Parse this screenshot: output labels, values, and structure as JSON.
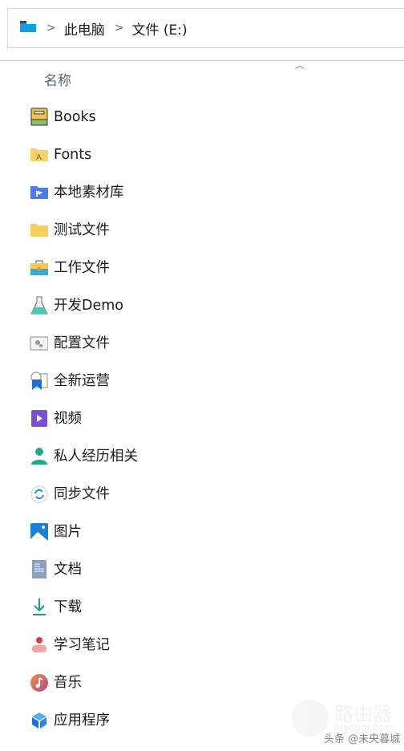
{
  "address_bar": {
    "icon": "folder-icon",
    "crumbs": [
      "此电脑",
      "文件 (E:)"
    ]
  },
  "column_header": {
    "name": "名称",
    "sort": "ascending"
  },
  "items": [
    {
      "label": "Books",
      "icon": "book-icon"
    },
    {
      "label": "Fonts",
      "icon": "fonts-folder-icon"
    },
    {
      "label": "本地素材库",
      "icon": "blue-folder-icon"
    },
    {
      "label": "测试文件",
      "icon": "folder-icon"
    },
    {
      "label": "工作文件",
      "icon": "briefcase-icon"
    },
    {
      "label": "开发Demo",
      "icon": "flask-icon"
    },
    {
      "label": "配置文件",
      "icon": "settings-file-icon"
    },
    {
      "label": "全新运营",
      "icon": "bookmark-doc-icon"
    },
    {
      "label": "视频",
      "icon": "video-icon"
    },
    {
      "label": "私人经历相关",
      "icon": "person-icon"
    },
    {
      "label": "同步文件",
      "icon": "sync-icon"
    },
    {
      "label": "图片",
      "icon": "picture-icon"
    },
    {
      "label": "文档",
      "icon": "document-icon"
    },
    {
      "label": "下载",
      "icon": "download-icon"
    },
    {
      "label": "学习笔记",
      "icon": "notes-icon"
    },
    {
      "label": "音乐",
      "icon": "music-icon"
    },
    {
      "label": "应用程序",
      "icon": "apps-icon"
    }
  ],
  "watermark": {
    "title": "路由器",
    "url": "luyouqi.com",
    "byline": "头条 @未央暮城"
  }
}
